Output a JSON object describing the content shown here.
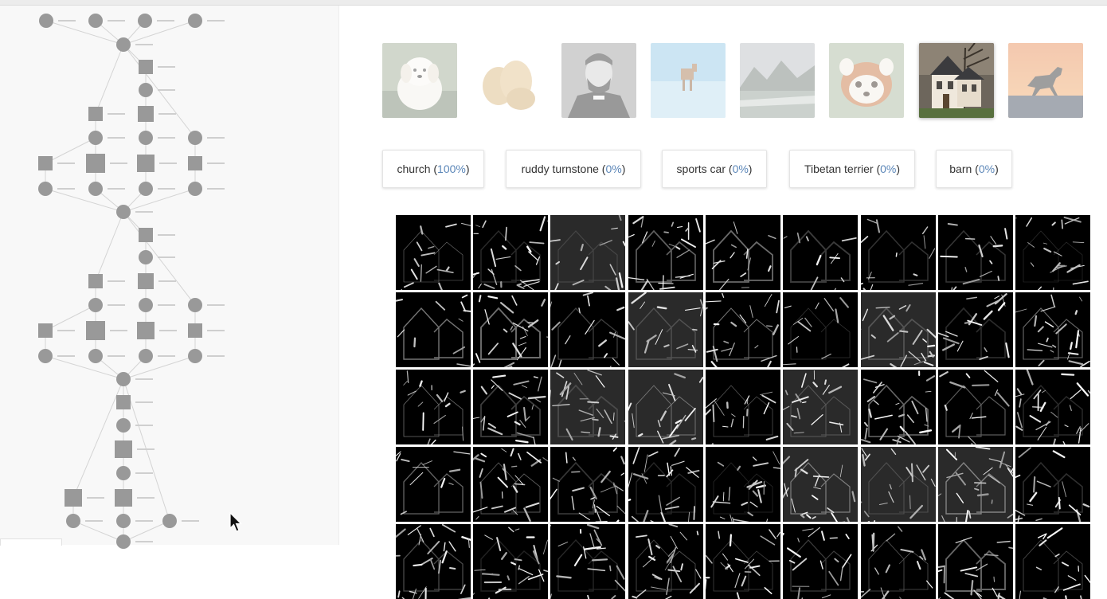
{
  "predictions": [
    {
      "label": "church",
      "pct": "100%"
    },
    {
      "label": "ruddy turnstone",
      "pct": "0%"
    },
    {
      "label": "sports car",
      "pct": "0%"
    },
    {
      "label": "Tibetan terrier",
      "pct": "0%"
    },
    {
      "label": "barn",
      "pct": "0%"
    }
  ],
  "thumbnails": [
    {
      "name": "puppy",
      "selected": false
    },
    {
      "name": "potatoes",
      "selected": false
    },
    {
      "name": "lincoln-portrait",
      "selected": false
    },
    {
      "name": "deer-on-ice",
      "selected": false
    },
    {
      "name": "mountain-lake",
      "selected": false
    },
    {
      "name": "red-panda",
      "selected": false
    },
    {
      "name": "house",
      "selected": true
    },
    {
      "name": "horse-silhouette",
      "selected": false
    }
  ],
  "feature_map_grid": {
    "columns": 9,
    "visible_rows": 5
  },
  "colors": {
    "prediction_pct": "#5b86b8",
    "graph_node": "#999999",
    "feature_bg": "#000000"
  },
  "icons": [
    "mouse-pointer-icon"
  ]
}
